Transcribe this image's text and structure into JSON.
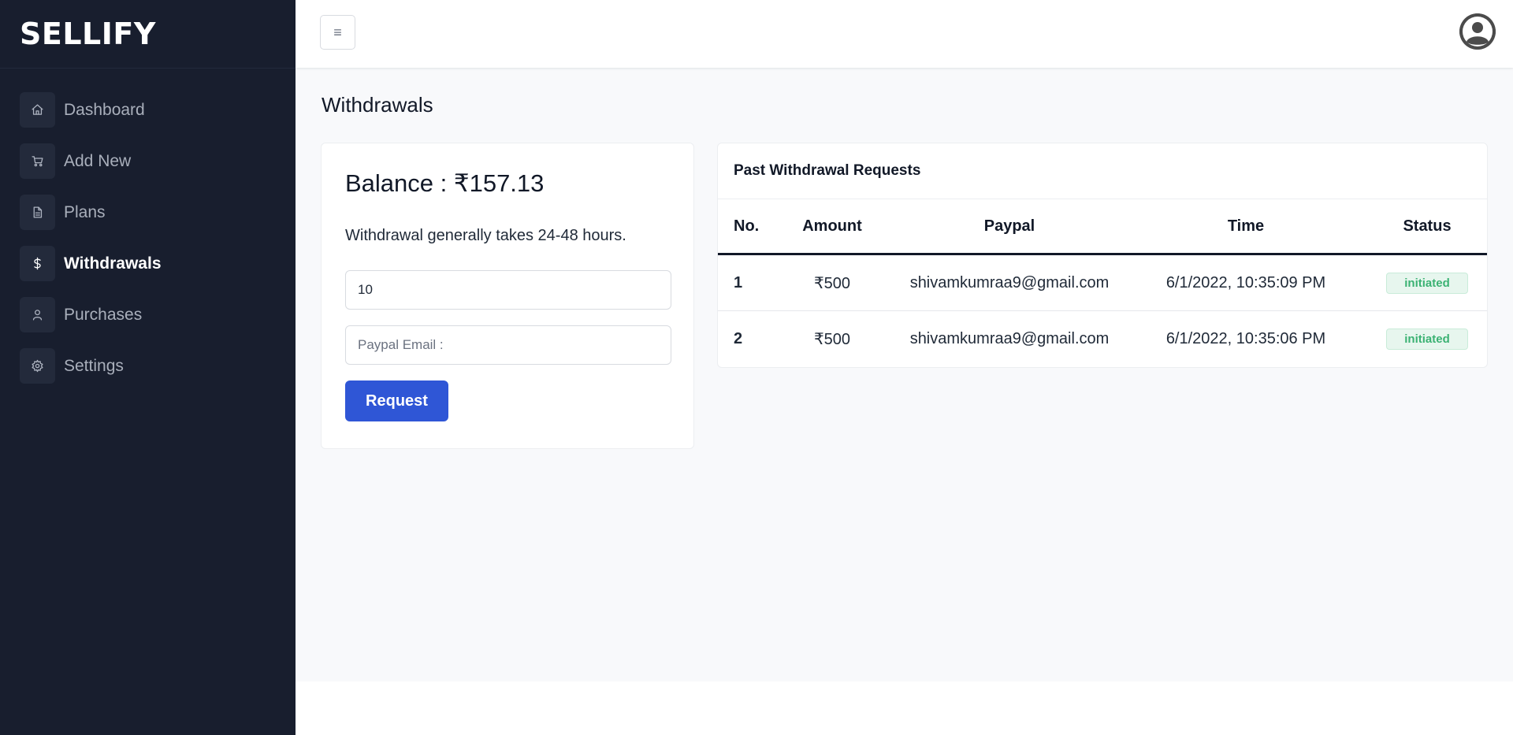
{
  "brand": {
    "name": "SELLIFY"
  },
  "sidebar": {
    "items": [
      {
        "label": "Dashboard",
        "icon": "home-icon",
        "active": false
      },
      {
        "label": "Add New",
        "icon": "cart-icon",
        "active": false
      },
      {
        "label": "Plans",
        "icon": "document-icon",
        "active": false
      },
      {
        "label": "Withdrawals",
        "icon": "dollar-icon",
        "active": true
      },
      {
        "label": "Purchases",
        "icon": "user-icon",
        "active": false
      },
      {
        "label": "Settings",
        "icon": "gear-icon",
        "active": false
      }
    ]
  },
  "topbar": {
    "menu_icon": "≡",
    "avatar_icon": "user-avatar-icon"
  },
  "main": {
    "page_title": "Withdrawals",
    "balance": {
      "text": "Balance : ₹157.13",
      "note": "Withdrawal generally takes 24-48 hours.",
      "amount_value": "10",
      "email_placeholder": "Paypal Email :",
      "request_label": "Request"
    },
    "history": {
      "title": "Past Withdrawal Requests",
      "columns": [
        "No.",
        "Amount",
        "Paypal",
        "Time",
        "Status"
      ],
      "rows": [
        {
          "no": "1",
          "amount": "₹500",
          "paypal": "shivamkumraa9@gmail.com",
          "time": "6/1/2022, 10:35:09 PM",
          "status": "initiated"
        },
        {
          "no": "2",
          "amount": "₹500",
          "paypal": "shivamkumraa9@gmail.com",
          "time": "6/1/2022, 10:35:06 PM",
          "status": "initiated"
        }
      ]
    }
  },
  "colors": {
    "sidebar_bg": "#181e2e",
    "accent": "#2f56d6",
    "status_green": "#3bb273",
    "main_bg": "#f8f9fb"
  }
}
